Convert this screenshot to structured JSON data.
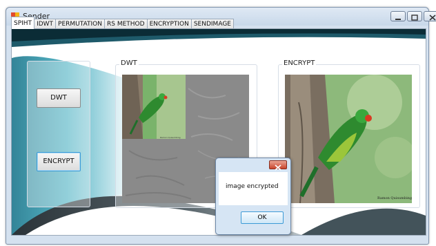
{
  "window": {
    "title": "Sender"
  },
  "tabs": [
    {
      "label": "SPIHT",
      "active": true
    },
    {
      "label": "IDWT",
      "active": false
    },
    {
      "label": "PERMUTATION",
      "active": false
    },
    {
      "label": "RS METHOD",
      "active": false
    },
    {
      "label": "ENCRYPTION",
      "active": false
    },
    {
      "label": "SENDIMAGE",
      "active": false
    }
  ],
  "panels": {
    "dwt_title": "DWT",
    "encrypt_title": "ENCRYPT",
    "photo_credit": "Ramon Quisumbing"
  },
  "buttons": {
    "dwt_label": "DWT",
    "encrypt_label": "ENCRYPT"
  },
  "dialog": {
    "message": "image encrypted",
    "ok_label": "OK"
  },
  "colors": {
    "accent": "#3c9ad6",
    "window_frame": "#d4e1ef",
    "teal_art": "#2a93a8"
  },
  "icons": {
    "app": "application-icon",
    "minimize": "minimize-icon",
    "maximize": "maximize-icon",
    "close": "close-icon"
  }
}
